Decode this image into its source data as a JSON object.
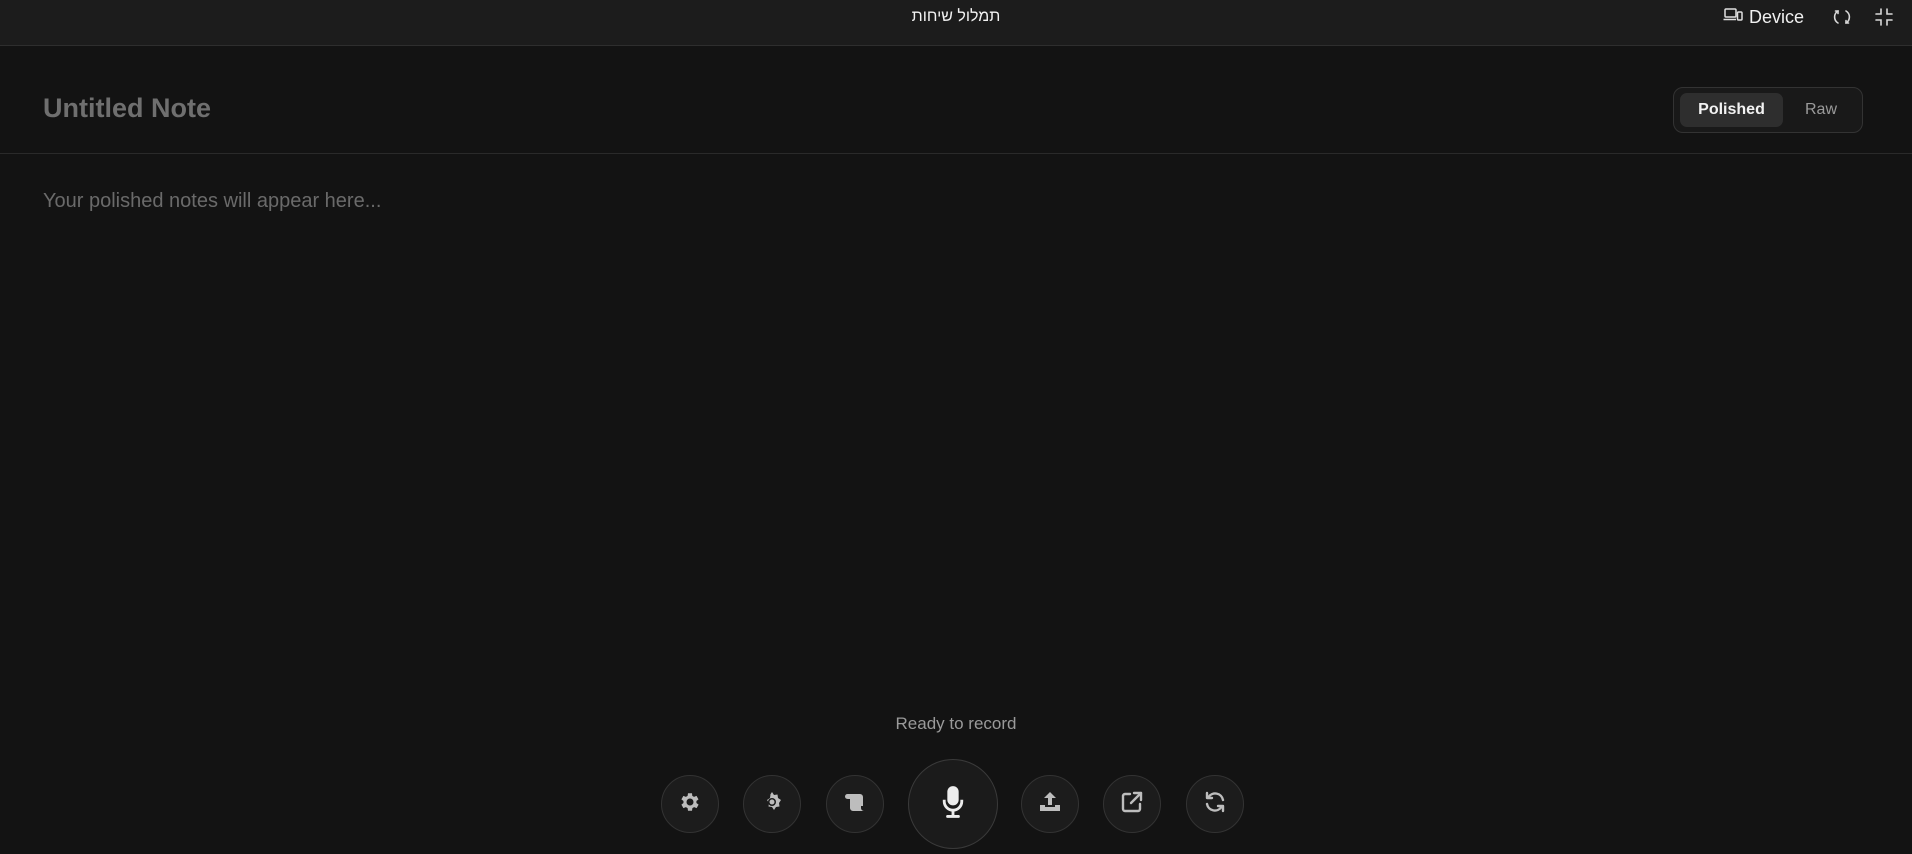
{
  "window": {
    "title": "תמלול שיחות",
    "device_label": "Device",
    "icons": [
      "device-icon",
      "rotate-icon",
      "exit-fullscreen-icon"
    ]
  },
  "note": {
    "title_placeholder": "Untitled Note",
    "body_placeholder": "Your polished notes will appear here..."
  },
  "view_toggle": {
    "options": [
      "Polished",
      "Raw"
    ],
    "selected": "Polished"
  },
  "status": {
    "text": "Ready to record"
  },
  "controls": {
    "buttons": [
      "settings-icon",
      "theme-gear-icon",
      "scroll-icon",
      "microphone-icon",
      "upload-icon",
      "external-link-icon",
      "refresh-icon"
    ]
  },
  "colors": {
    "background": "#131313",
    "topbar": "#1c1c1c",
    "placeholder_text": "#6a6a6a",
    "accent_text": "#f2f2f2"
  }
}
